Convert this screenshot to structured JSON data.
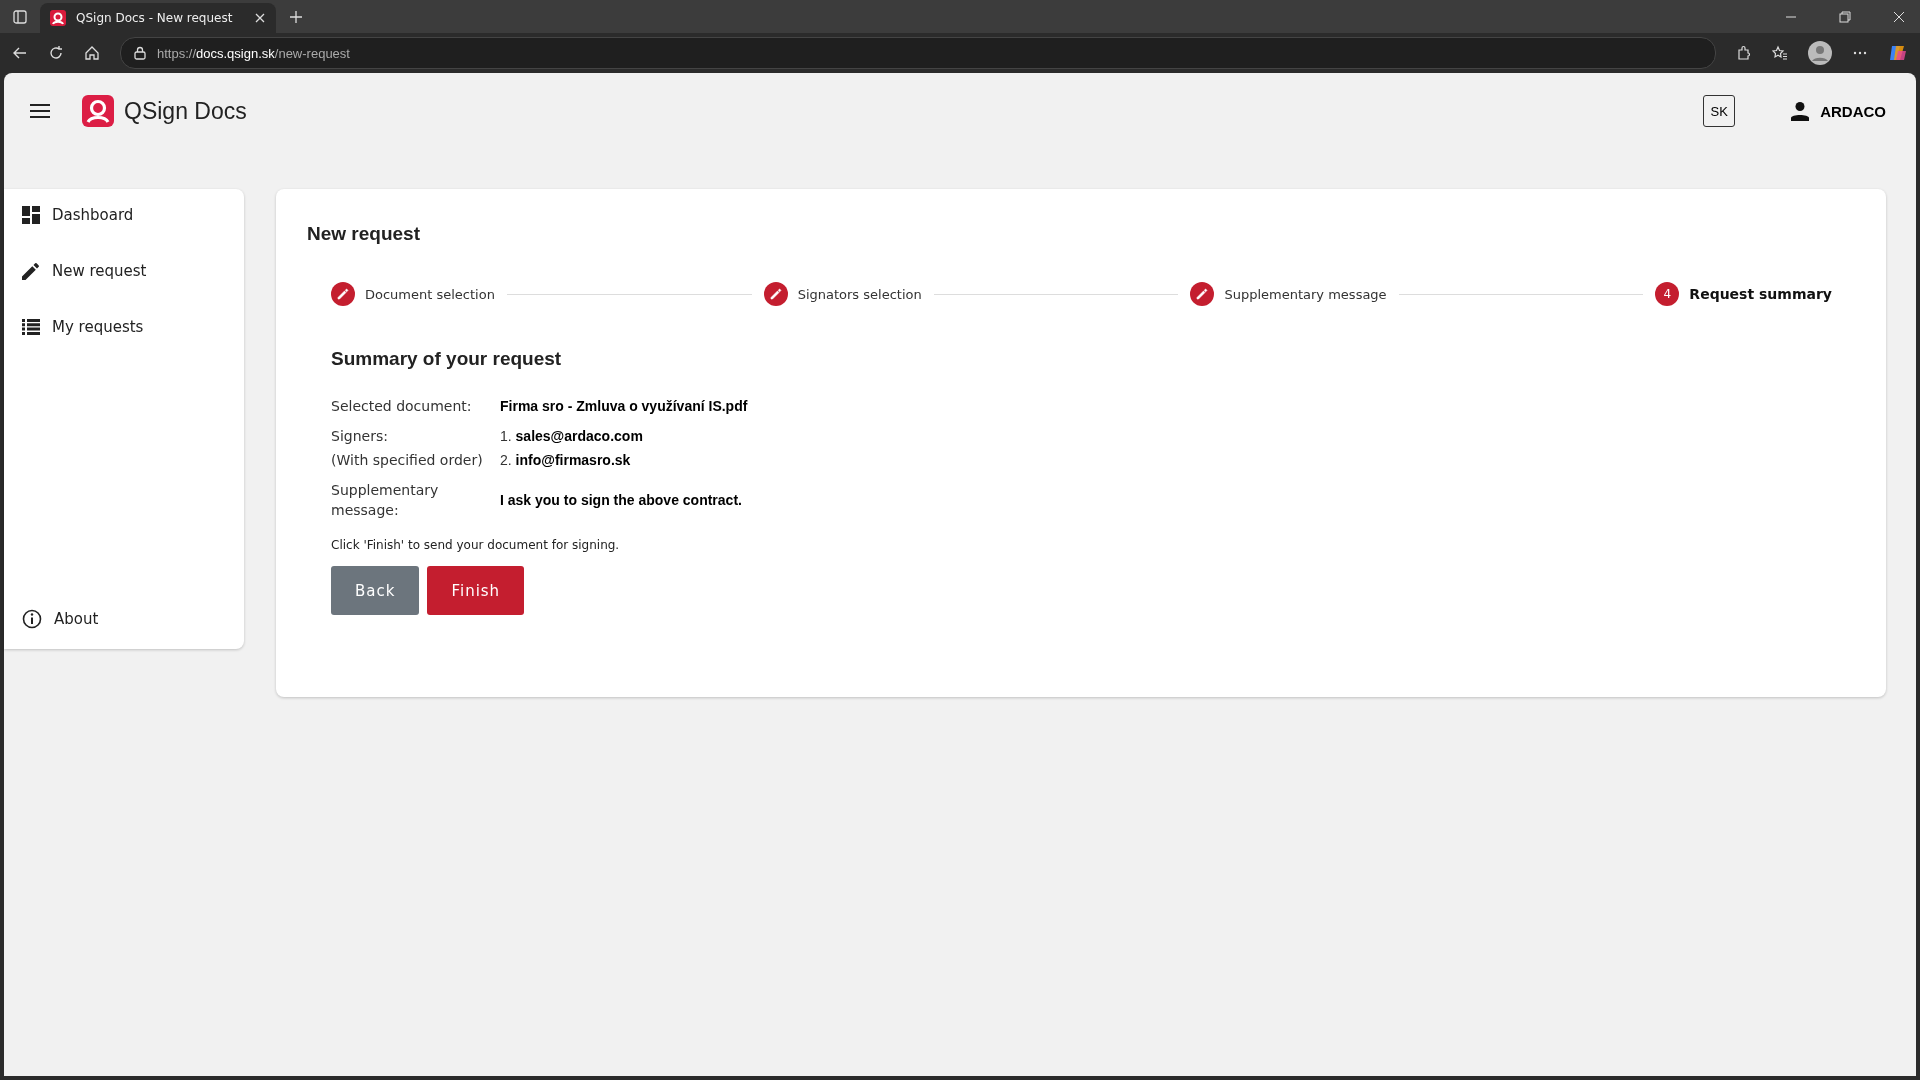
{
  "browser": {
    "tab_title": "QSign Docs - New request",
    "url_prefix": "https://",
    "url_host": "docs.qsign.sk",
    "url_path": "/new-request"
  },
  "header": {
    "app_name": "QSign Docs",
    "language": "SK",
    "user": "ARDACO"
  },
  "sidebar": {
    "items": [
      {
        "label": "Dashboard",
        "kind": "dashboard",
        "selected": false
      },
      {
        "label": "New request",
        "kind": "pencil",
        "selected": false
      },
      {
        "label": "My requests",
        "kind": "list",
        "selected": false
      }
    ],
    "footer_item": {
      "label": "About"
    }
  },
  "page": {
    "title": "New request",
    "steps": [
      {
        "label": "Document selection",
        "kind": "done"
      },
      {
        "label": "Signators selection",
        "kind": "done"
      },
      {
        "label": "Supplementary message",
        "kind": "done"
      },
      {
        "label": "Request summary",
        "kind": "current",
        "number": "4"
      }
    ],
    "summary_title": "Summary of your request",
    "document_label": "Selected document:",
    "document": "Firma sro - Zmluva o využívaní IS.pdf",
    "signers_label": "Signers:",
    "signers_note": "(With specified order)",
    "signers": [
      {
        "number": "1.",
        "email": "sales@ardaco.com"
      },
      {
        "number": "2.",
        "email": "info@firmasro.sk"
      }
    ],
    "message_label": "Supplementary message:",
    "message": "I ask you to sign the above contract.",
    "hint": "Click 'Finish' to send your document for signing.",
    "buttons": [
      {
        "label": "Back",
        "kind": "secondary"
      },
      {
        "label": "Finish",
        "kind": "primary"
      }
    ]
  }
}
